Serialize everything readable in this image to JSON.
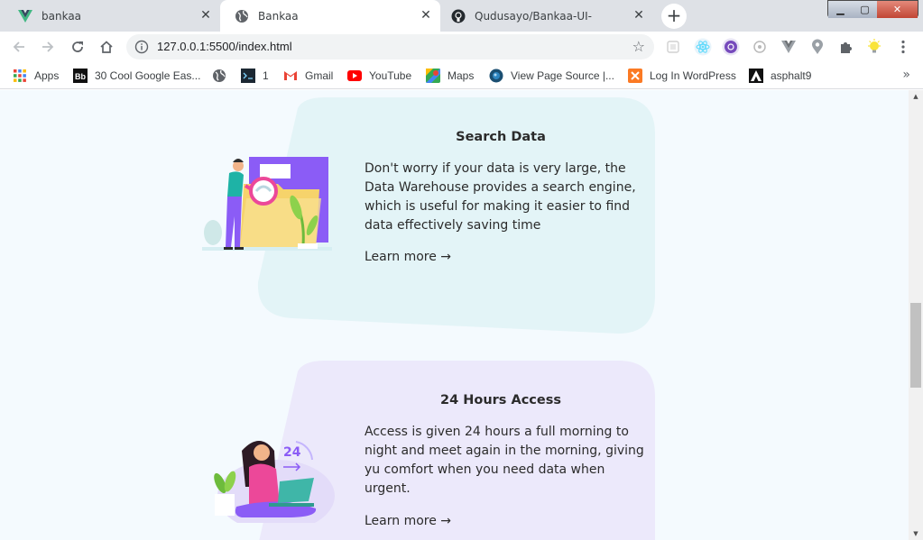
{
  "tabs": [
    {
      "title": "bankaa",
      "icon": "vue-icon",
      "active": false
    },
    {
      "title": "Bankaa",
      "icon": "globe-icon",
      "active": true
    },
    {
      "title": "Qudusayo/Bankaa-UI-",
      "icon": "github-icon",
      "active": false
    }
  ],
  "newtab_label": "+",
  "window_controls": {
    "minimize": "▁",
    "maximize": "▢",
    "close": "✕"
  },
  "address_bar": {
    "url": "127.0.0.1:5500/index.html"
  },
  "bookmarks": [
    {
      "label": "Apps",
      "icon": "apps-grid-icon"
    },
    {
      "label": "30 Cool Google Eas...",
      "icon": "bb-icon"
    },
    {
      "label": "",
      "icon": "globe-icon"
    },
    {
      "label": "1",
      "icon": "terminal-icon"
    },
    {
      "label": "Gmail",
      "icon": "gmail-icon"
    },
    {
      "label": "YouTube",
      "icon": "youtube-icon"
    },
    {
      "label": "Maps",
      "icon": "maps-icon"
    },
    {
      "label": "View Page Source |...",
      "icon": "view-source-icon"
    },
    {
      "label": "Log In WordPress",
      "icon": "xampp-icon"
    },
    {
      "label": "asphalt9",
      "icon": "asphalt-icon"
    }
  ],
  "bookmarks_overflow": "»",
  "colors": {
    "page_bg": "#f4fafe",
    "card1_bg": "#e3f4f7",
    "card2_bg": "#ece9fb",
    "accent_purple": "#8b5cf6"
  },
  "cards": [
    {
      "title": "Search Data",
      "text": "Don't worry if your data is very large, the Data Warehouse provides a search engine, which is useful for making it easier to find data effectively saving time",
      "link": "Learn more →",
      "illustration": "search-data-illustration"
    },
    {
      "title": "24 Hours Access",
      "text": "Access is given 24 hours a full morning to night and meet again in the morning, giving yu comfort when you need data when urgent.",
      "link": "Learn more →",
      "illustration": "24-hours-access-illustration",
      "illustration_text": "24"
    }
  ]
}
